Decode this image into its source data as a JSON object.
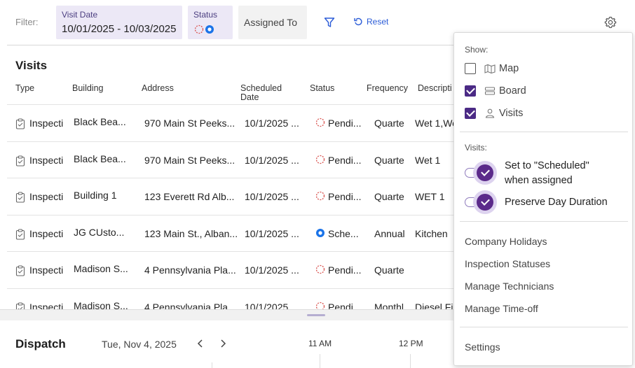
{
  "filter": {
    "label": "Filter:",
    "visit_date": {
      "caption": "Visit Date",
      "value": "10/01/2025 - 10/03/2025"
    },
    "status": {
      "caption": "Status"
    },
    "assigned_to": {
      "label": "Assigned To"
    },
    "reset_label": "Reset"
  },
  "visits": {
    "title": "Visits",
    "columns": [
      "Type",
      "Building",
      "Address",
      "Scheduled Date",
      "Status",
      "Frequency",
      "Descripti"
    ],
    "rows": [
      {
        "type": "Inspecti",
        "building": "Black Bea...",
        "address": "970 Main St Peeks...",
        "date": "10/1/2025 ...",
        "status": "Pendi...",
        "status_kind": "pending",
        "frequency": "Quarter",
        "description": "Wet 1,We"
      },
      {
        "type": "Inspecti",
        "building": "Black Bea...",
        "address": "970 Main St Peeks...",
        "date": "10/1/2025 ...",
        "status": "Pendi...",
        "status_kind": "pending",
        "frequency": "Quarter",
        "description": "Wet 1"
      },
      {
        "type": "Inspecti",
        "building": "Building 1",
        "address": "123 Everett Rd Alb...",
        "date": "10/1/2025 ...",
        "status": "Pendi...",
        "status_kind": "pending",
        "frequency": "Quarter",
        "description": "WET 1"
      },
      {
        "type": "Inspecti",
        "building": "JG CUsto...",
        "address": "123 Main St., Alban...",
        "date": "10/1/2025 ...",
        "status": "Sche...",
        "status_kind": "scheduled",
        "frequency": "Annual",
        "description": "Kitchen"
      },
      {
        "type": "Inspecti",
        "building": "Madison S...",
        "address": "4 Pennsylvania Pla...",
        "date": "10/1/2025 ...",
        "status": "Pendi...",
        "status_kind": "pending",
        "frequency": "Quarter",
        "description": ""
      },
      {
        "type": "Inspecti",
        "building": "Madison S...",
        "address": "4 Pennsylvania Pla...",
        "date": "10/1/2025 ...",
        "status": "Pendi...",
        "status_kind": "pending",
        "frequency": "Monthl",
        "description": "Diesel Fi"
      }
    ]
  },
  "dispatch": {
    "title": "Dispatch",
    "date": "Tue, Nov 4, 2025",
    "time_labels": [
      "11 AM",
      "12 PM"
    ]
  },
  "panel": {
    "show_header": "Show:",
    "show_options": [
      {
        "label": "Map",
        "checked": false,
        "icon": "map-icon"
      },
      {
        "label": "Board",
        "checked": true,
        "icon": "board-icon"
      },
      {
        "label": "Visits",
        "checked": true,
        "icon": "person-icon"
      }
    ],
    "visits_header": "Visits:",
    "toggles": [
      {
        "label_line1": "Set to \"Scheduled\"",
        "label_line2": "when assigned",
        "on": true
      },
      {
        "label_line1": "Preserve Day Duration",
        "label_line2": "",
        "on": true
      }
    ],
    "links": [
      "Company Holidays",
      "Inspection Statuses",
      "Manage Technicians",
      "Manage Time-off"
    ],
    "settings_label": "Settings"
  },
  "colors": {
    "accent": "#4b2a85",
    "link": "#2a5bd7",
    "pending": "#d9534f",
    "scheduled": "#1a73e8"
  }
}
